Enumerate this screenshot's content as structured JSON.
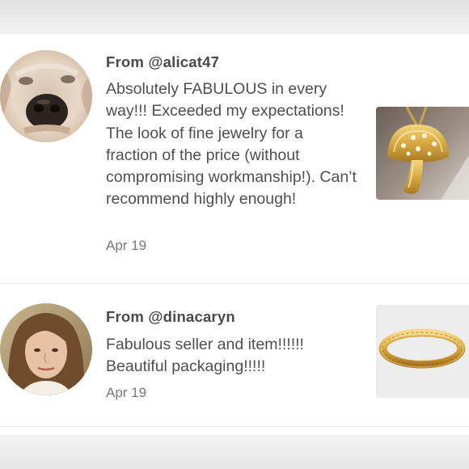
{
  "reviews": [
    {
      "author": "From @alicat47",
      "text": "Absolutely FABULOUS in every way!!! Exceeded my expectations! The look of fine jewelry for a fraction of the price (without compromising workmanship!). Can’t recommend highly enough!",
      "date": "Apr 19",
      "avatar_icon": "dog-photo-avatar",
      "thumbnail_icon": "mushroom-pendant-photo"
    },
    {
      "author": "From @dinacaryn",
      "text": "Fabulous seller and item!!!!!! Beautiful packaging!!!!!",
      "date": "Apr 19",
      "avatar_icon": "woman-photo-avatar",
      "thumbnail_icon": "gold-bracelet-photo"
    }
  ]
}
